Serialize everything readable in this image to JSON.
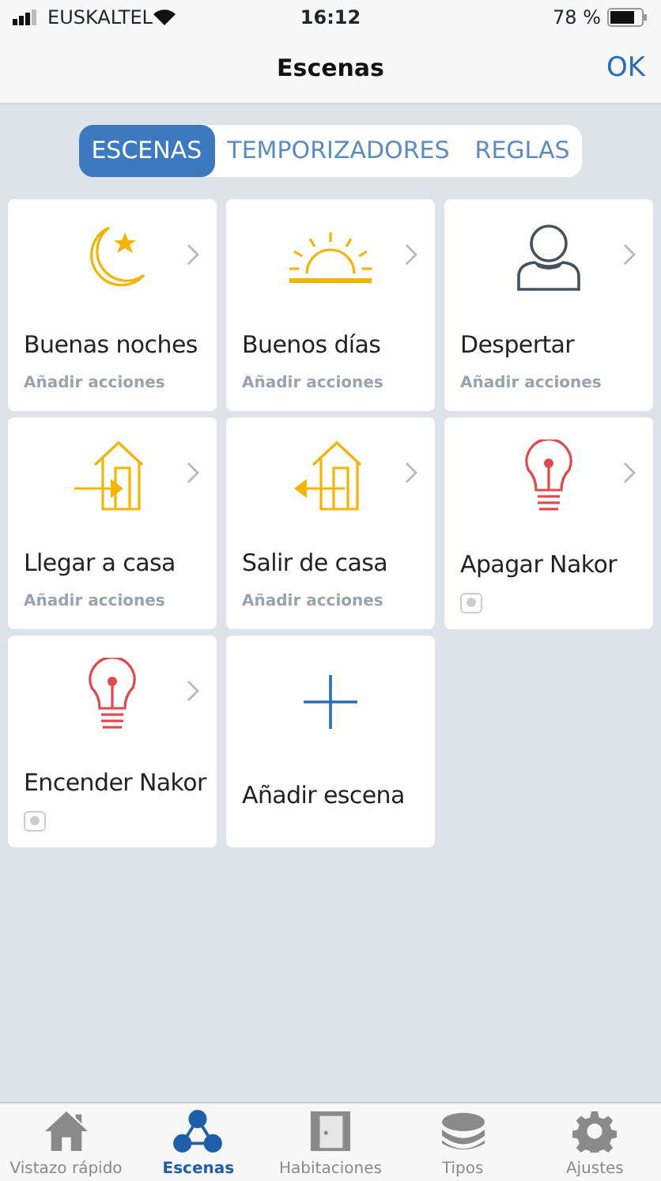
{
  "status_bar": {
    "carrier": "EUSKALTEL",
    "time": "16:12",
    "battery": "78 %"
  },
  "nav_bar": {
    "title": "Escenas",
    "action": "OK"
  },
  "segments": [
    {
      "label": "ESCENAS",
      "selected": true
    },
    {
      "label": "TEMPORIZADORES",
      "selected": false
    },
    {
      "label": "REGLAS",
      "selected": false
    }
  ],
  "scenes": [
    {
      "kind": "scene",
      "name": "Buenas noches",
      "subtitle": "Añadir acciones"
    },
    {
      "kind": "scene",
      "name": "Buenos días",
      "subtitle": "Añadir acciones"
    },
    {
      "kind": "scene",
      "name": "Despertar",
      "subtitle": "Añadir acciones"
    },
    {
      "kind": "scene",
      "name": "Llegar a casa",
      "subtitle": "Añadir acciones"
    },
    {
      "kind": "scene",
      "name": "Salir de casa",
      "subtitle": "Añadir acciones"
    },
    {
      "kind": "device",
      "name": "Apagar Nakor"
    },
    {
      "kind": "device",
      "name": "Encender Nakor"
    },
    {
      "kind": "add",
      "name": "Añadir escena"
    }
  ],
  "tab_bar": [
    {
      "label": "Vistazo rápido",
      "selected": false
    },
    {
      "label": "Escenas",
      "selected": true
    },
    {
      "label": "Habitaciones",
      "selected": false
    },
    {
      "label": "Tipos",
      "selected": false
    },
    {
      "label": "Ajustes",
      "selected": false
    }
  ]
}
